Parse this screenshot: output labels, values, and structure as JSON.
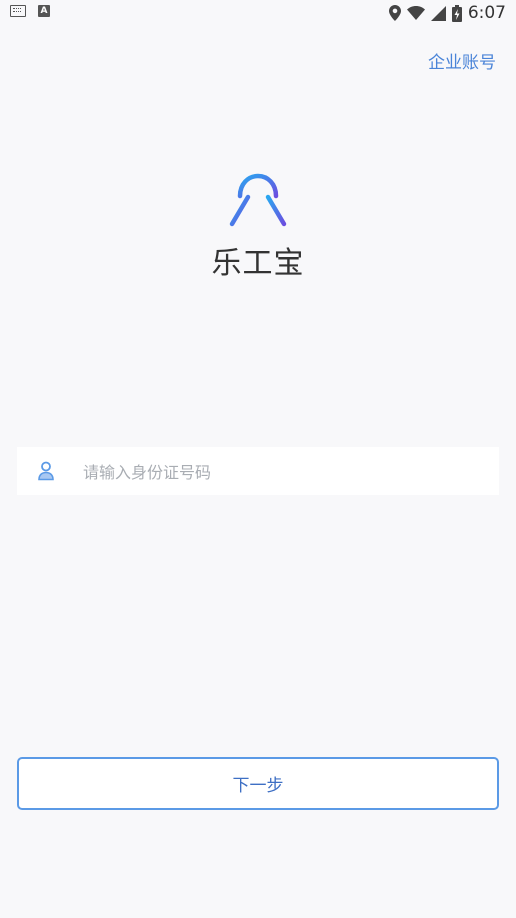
{
  "status_bar": {
    "time": "6:07",
    "icons": [
      "keyboard-icon",
      "a-icon",
      "location-icon",
      "wifi-icon",
      "signal-icon",
      "battery-charging-icon"
    ],
    "a_icon_text": "A"
  },
  "header": {
    "corp_account_label": "企业账号"
  },
  "brand": {
    "app_name": "乐工宝",
    "logo_colors": {
      "start": "#2aa7f0",
      "end": "#6a4fe0"
    }
  },
  "form": {
    "id_field": {
      "value": "",
      "placeholder": "请输入身份证号码",
      "icon": "user-icon"
    },
    "next_label": "下一步"
  },
  "colors": {
    "accent": "#4a84d8",
    "button_border": "#5b9ae6",
    "background": "#f8f8fa"
  }
}
